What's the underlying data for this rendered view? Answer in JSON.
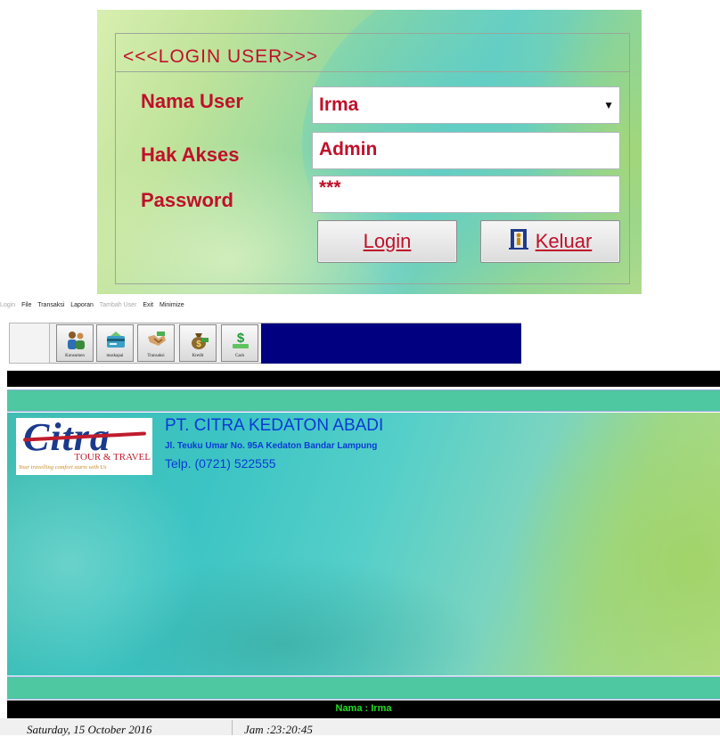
{
  "login": {
    "title": "<<<LOGIN USER>>>",
    "nama_user_label": "Nama User",
    "nama_user_value": "Irma",
    "hak_akses_label": "Hak Akses",
    "hak_akses_value": "Admin",
    "password_label": "Password",
    "password_value": "***",
    "login_button": "Login",
    "keluar_button": "Keluar",
    "accent_color": "#c0102a"
  },
  "menu": {
    "items": [
      "Login",
      "File",
      "Transaksi",
      "Laporan",
      "Tambah User",
      "Exit",
      "Minimize"
    ]
  },
  "toolbar": {
    "buttons": [
      {
        "label": "Konsumen",
        "icon": "people-icon"
      },
      {
        "label": "maskapai",
        "icon": "card-icon"
      },
      {
        "label": "Transaksi",
        "icon": "handshake-icon"
      },
      {
        "label": "Kredit",
        "icon": "money-bag-icon"
      },
      {
        "label": "Cash",
        "icon": "dollar-icon"
      }
    ]
  },
  "company": {
    "logo_main": "Citra",
    "logo_sub": "TOUR & TRAVEL",
    "logo_tagline": "Your travelling comfort starts with Us",
    "name": "PT. CITRA KEDATON ABADI",
    "address": "Jl. Teuku Umar No. 95A Kedaton Bandar Lampung",
    "telp": "Telp. (0721) 522555"
  },
  "footer": {
    "nama": "Nama : Irma",
    "date": "Saturday, 15 October 2016",
    "time": "Jam :23:20:45"
  }
}
